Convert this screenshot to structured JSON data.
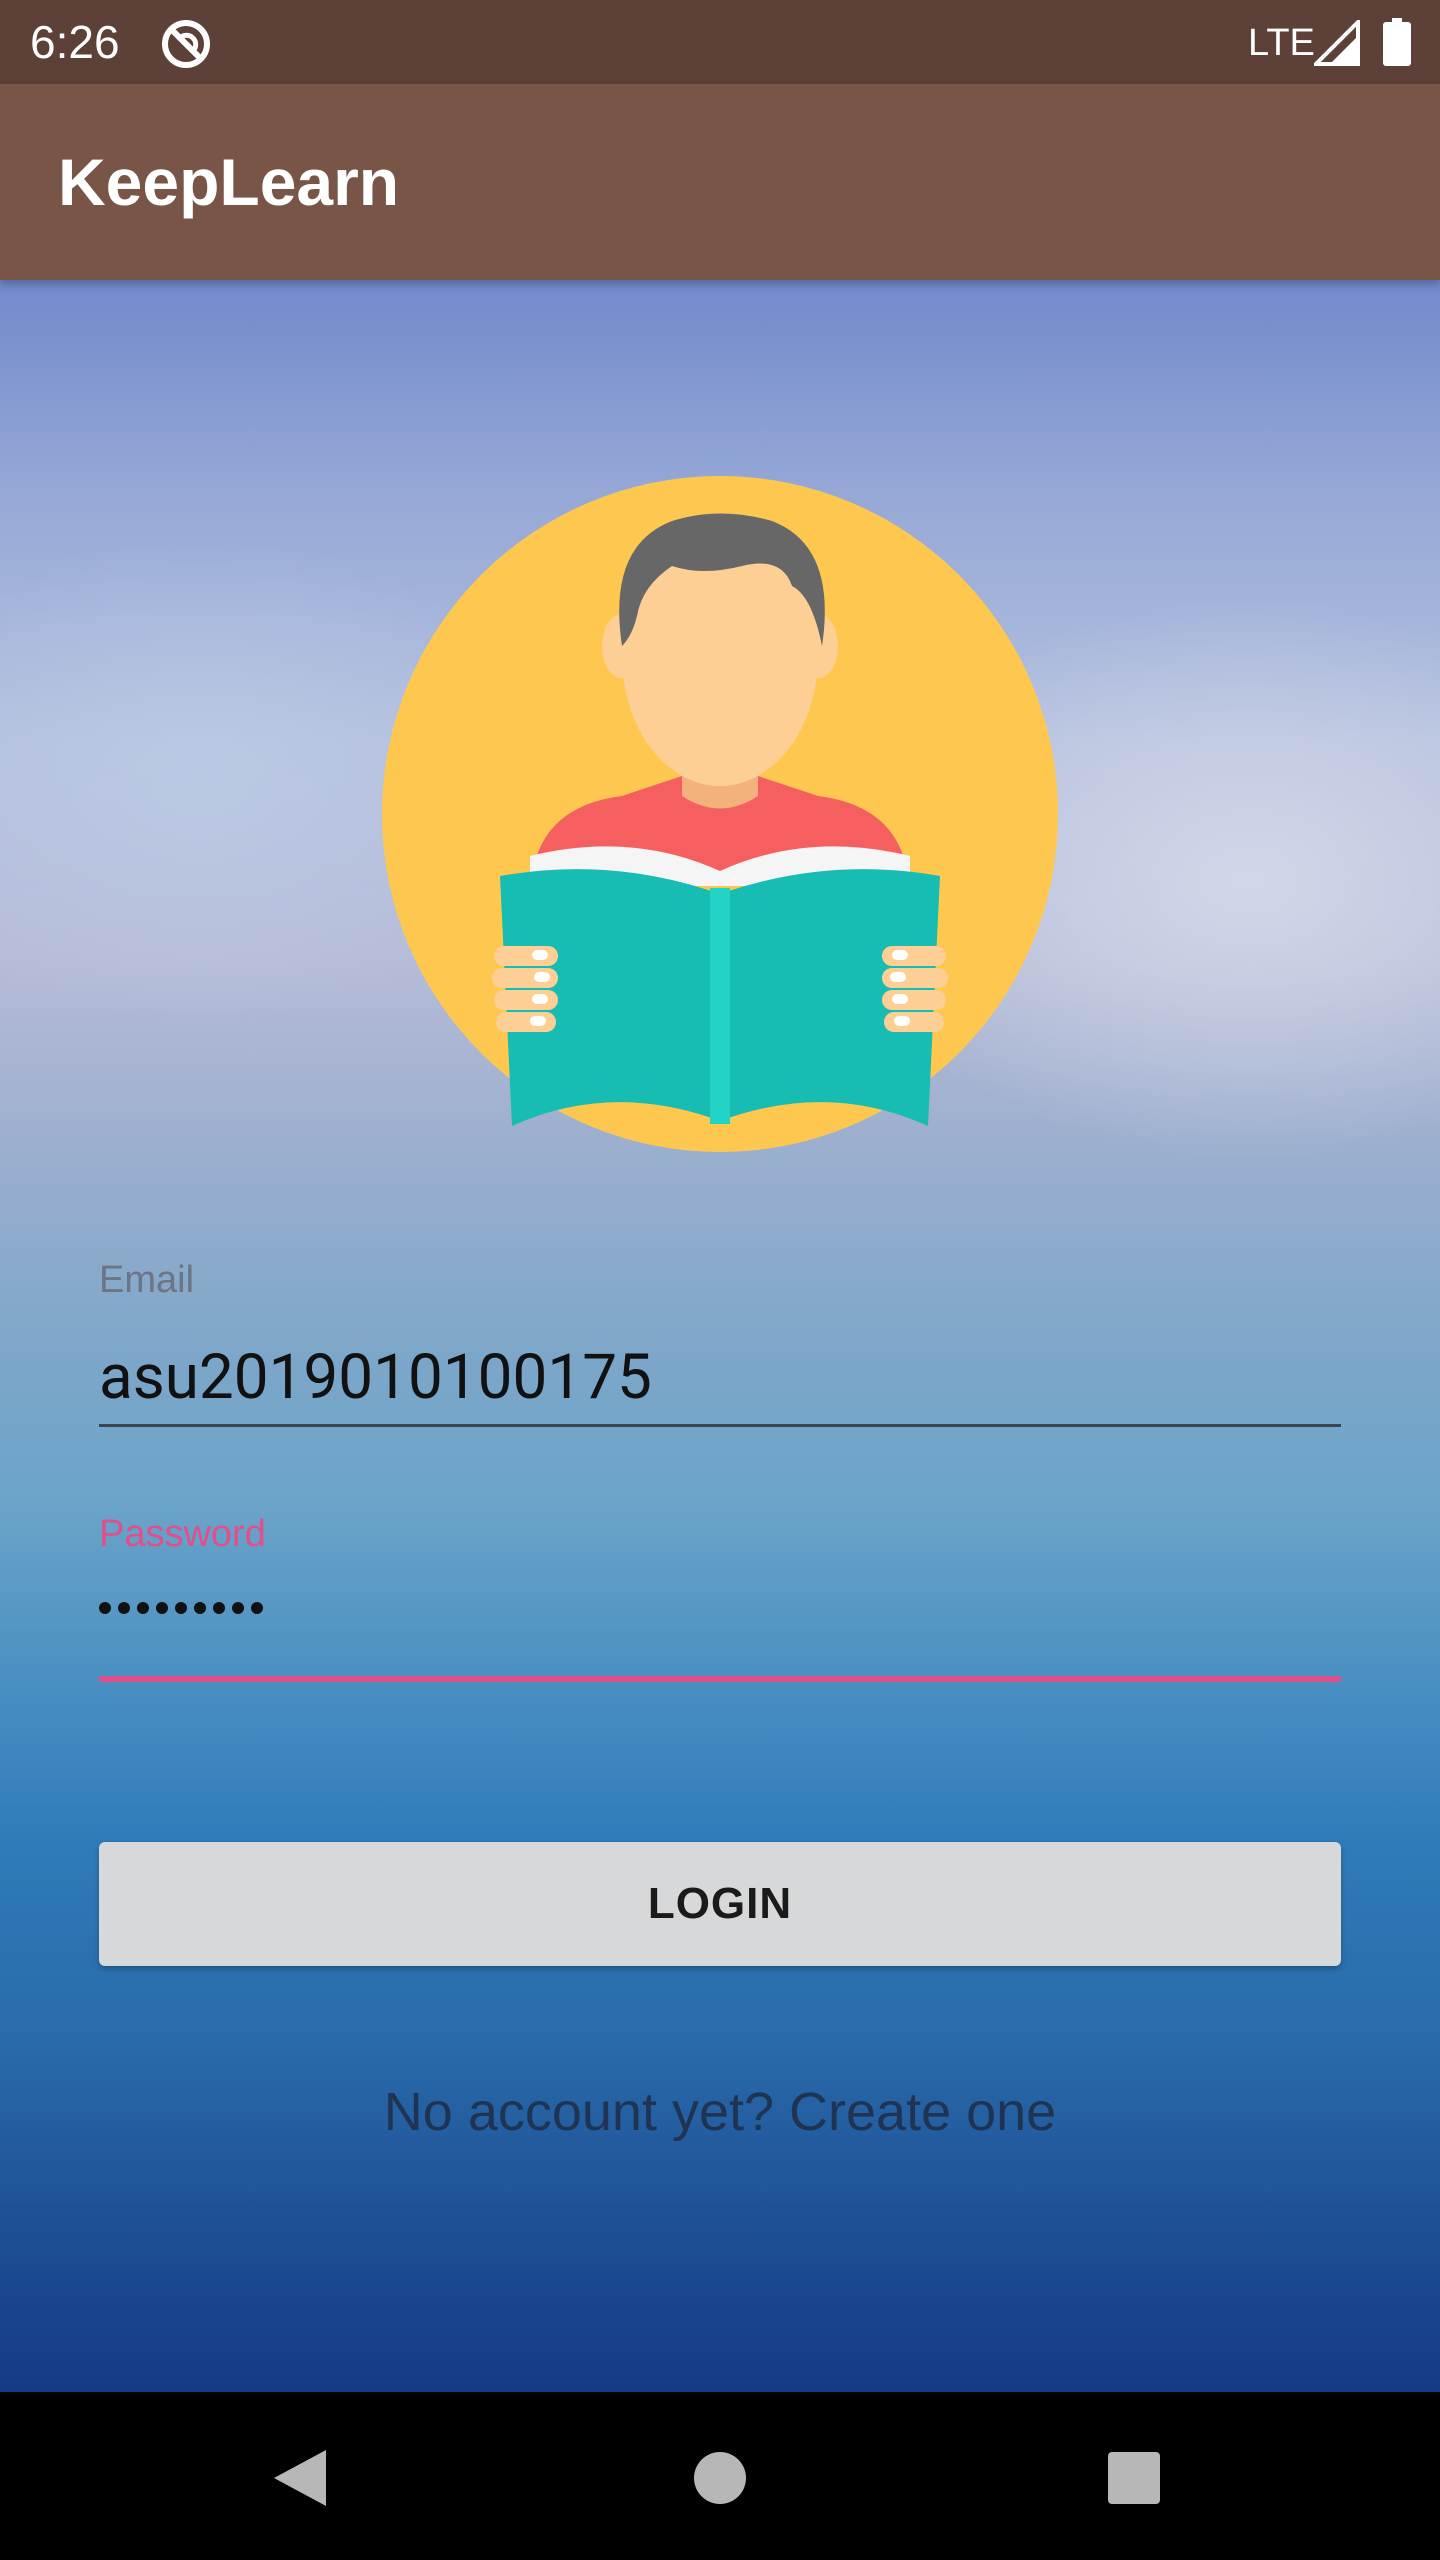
{
  "status_bar": {
    "time": "6:26",
    "network": "LTE",
    "icons": [
      "sync-icon",
      "signal-icon",
      "battery-icon"
    ]
  },
  "app_bar": {
    "title": "KeepLearn"
  },
  "avatar": {
    "icon": "reader-avatar-icon"
  },
  "form": {
    "email_label": "Email",
    "email_value": "asu2019010100175",
    "password_label": "Password",
    "password_masked_count": 9
  },
  "login_button": {
    "label": "LOGIN"
  },
  "signup": {
    "text": "No account yet? Create one"
  },
  "navigation": {
    "icons": [
      "back-icon",
      "home-icon",
      "recents-icon"
    ]
  },
  "colors": {
    "status_bar": "#5d4037",
    "app_bar": "#795548",
    "accent": "#e0508a",
    "button_bg": "#d7d8d9"
  }
}
